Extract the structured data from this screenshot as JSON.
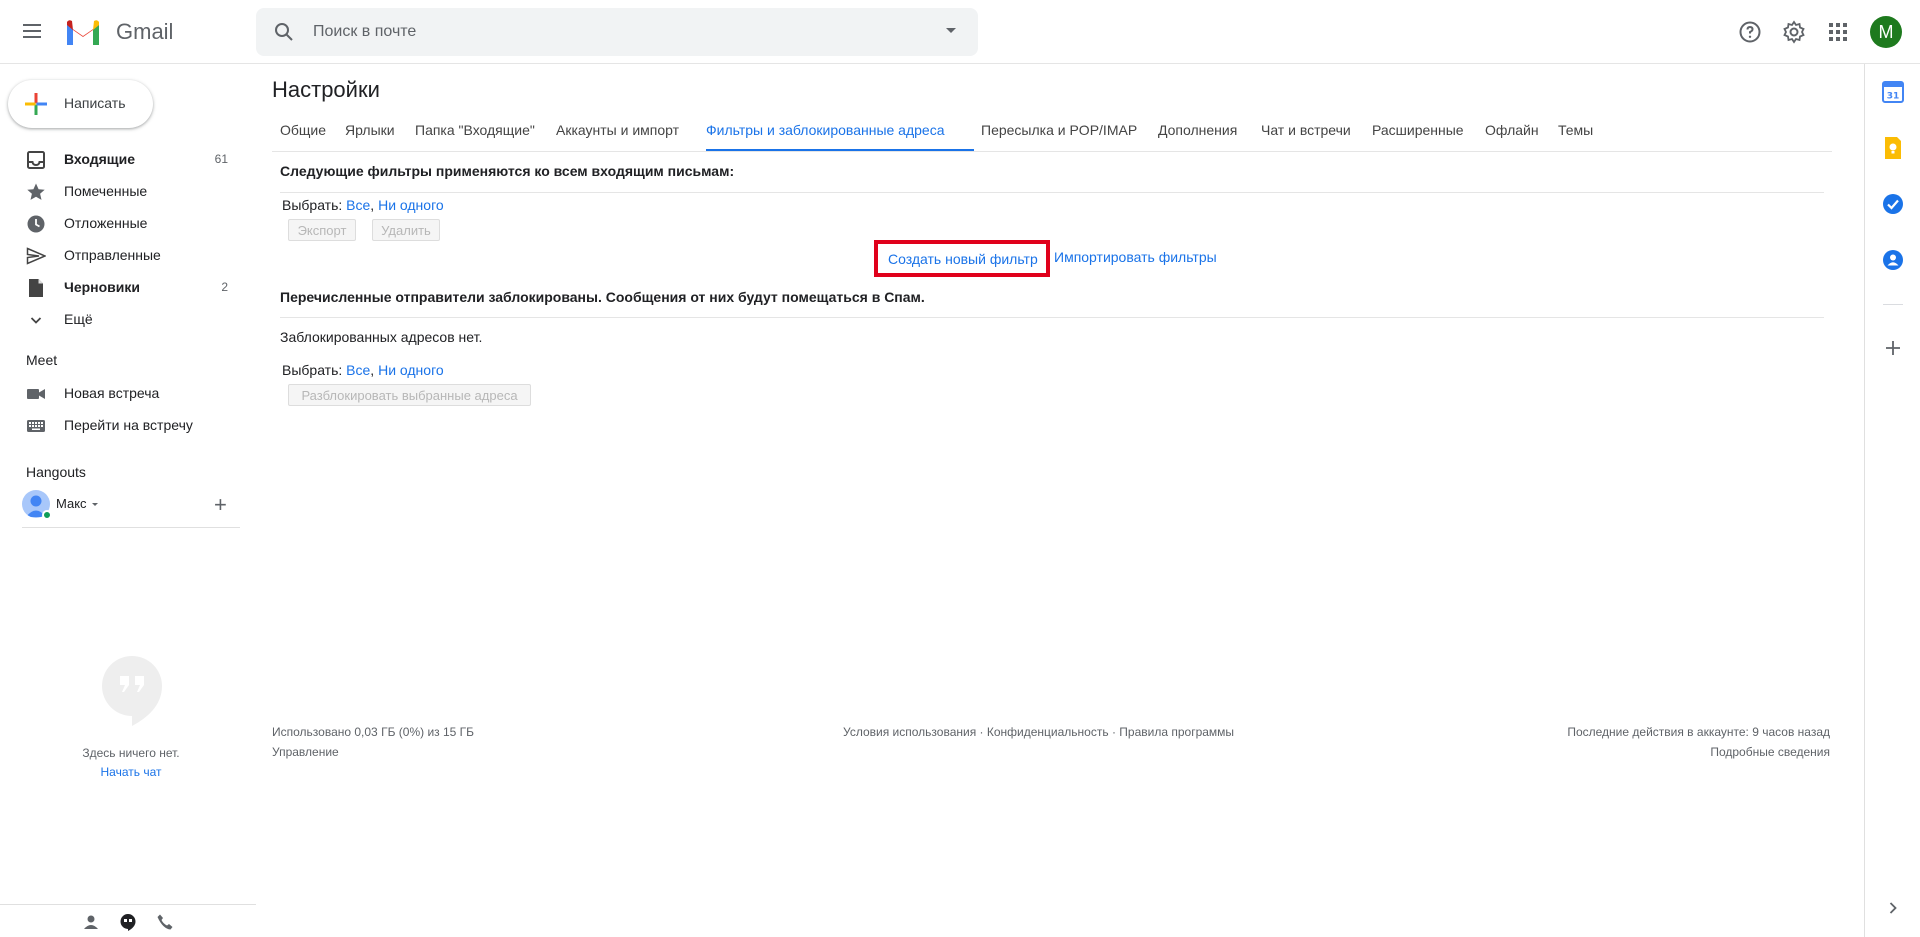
{
  "header": {
    "app_name": "Gmail",
    "search_placeholder": "Поиск в почте",
    "avatar_letter": "M"
  },
  "sidebar": {
    "compose_label": "Написать",
    "items": [
      {
        "label": "Входящие",
        "count": "61",
        "bold": true,
        "icon": "inbox-icon"
      },
      {
        "label": "Помеченные",
        "count": "",
        "bold": false,
        "icon": "star-icon"
      },
      {
        "label": "Отложенные",
        "count": "",
        "bold": false,
        "icon": "clock-icon"
      },
      {
        "label": "Отправленные",
        "count": "",
        "bold": false,
        "icon": "send-icon"
      },
      {
        "label": "Черновики",
        "count": "2",
        "bold": true,
        "icon": "draft-icon"
      },
      {
        "label": "Ещё",
        "count": "",
        "bold": false,
        "icon": "chevron-down-icon"
      }
    ],
    "meet": {
      "title": "Meet",
      "items": [
        {
          "label": "Новая встреча",
          "icon": "video-icon"
        },
        {
          "label": "Перейти на встречу",
          "icon": "keyboard-icon"
        }
      ]
    },
    "hangouts": {
      "title": "Hangouts",
      "user_name": "Макс",
      "empty_text": "Здесь ничего нет.",
      "start_chat": "Начать чат"
    }
  },
  "main": {
    "title": "Настройки",
    "tabs": [
      {
        "label": "Общие"
      },
      {
        "label": "Ярлыки"
      },
      {
        "label": "Папка \"Входящие\""
      },
      {
        "label": "Аккаунты и импорт"
      },
      {
        "label": "Фильтры и заблокированные адреса",
        "active": true
      },
      {
        "label": "Пересылка и POP/IMAP"
      },
      {
        "label": "Дополнения"
      },
      {
        "label": "Чат и встречи"
      },
      {
        "label": "Расширенные"
      },
      {
        "label": "Офлайн"
      },
      {
        "label": "Темы"
      }
    ],
    "filters": {
      "heading": "Следующие фильтры применяются ко всем входящим письмам:",
      "select_label": "Выбрать:",
      "select_all": "Все",
      "select_none": "Ни одного",
      "export_btn": "Экспорт",
      "delete_btn": "Удалить",
      "create_filter": "Создать новый фильтр",
      "import_filters": "Импортировать фильтры"
    },
    "blocked": {
      "heading": "Перечисленные отправители заблокированы. Сообщения от них будут помещаться в Спам.",
      "empty_text": "Заблокированных адресов нет.",
      "select_label": "Выбрать:",
      "select_all": "Все",
      "select_none": "Ни одного",
      "unblock_btn": "Разблокировать выбранные адреса"
    }
  },
  "footer": {
    "storage": "Использовано 0,03 ГБ (0%) из 15 ГБ",
    "manage": "Управление",
    "terms": "Условия использования",
    "privacy": "Конфиденциальность",
    "policies": "Правила программы",
    "separator": " · ",
    "last_activity": "Последние действия в аккаунте: 9 часов назад",
    "details": "Подробные сведения"
  },
  "colors": {
    "accent": "#1a73e8",
    "highlight_box": "#e0001b",
    "avatar_bg": "#1e7a1e"
  }
}
